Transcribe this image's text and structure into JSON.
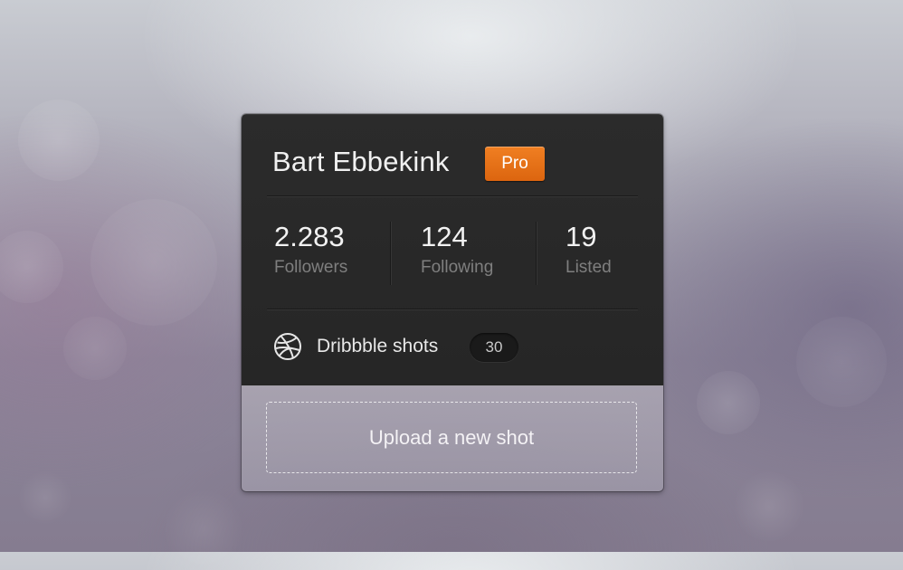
{
  "profile": {
    "name": "Bart Ebbekink",
    "badge": "Pro"
  },
  "stats": [
    {
      "value": "2.283",
      "label": "Followers"
    },
    {
      "value": "124",
      "label": "Following"
    },
    {
      "value": "19",
      "label": "Listed"
    }
  ],
  "shots": {
    "icon": "dribbble-icon",
    "label": "Dribbble shots",
    "count": "30"
  },
  "upload": {
    "label": "Upload a new shot"
  },
  "colors": {
    "accent": "#e8721a",
    "card_dark": "#282828"
  }
}
